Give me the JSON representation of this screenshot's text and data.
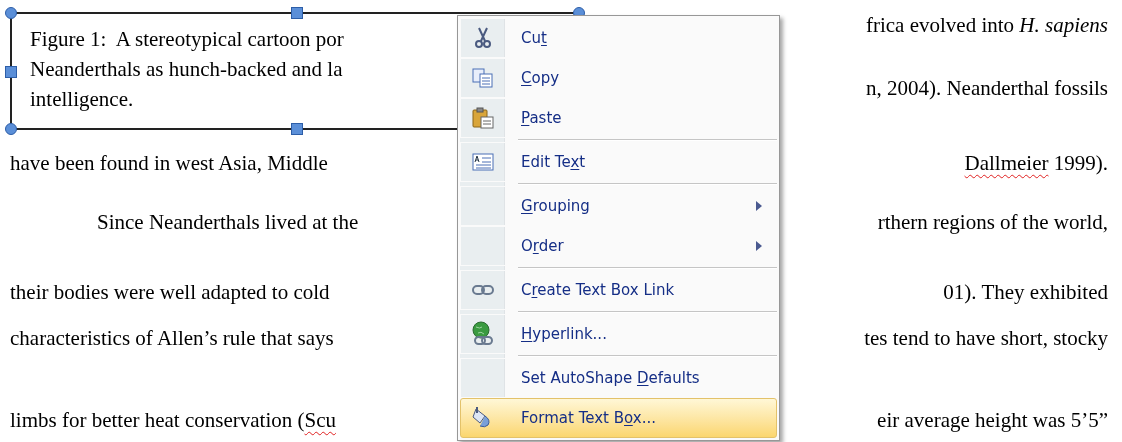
{
  "text_box": {
    "selected": true,
    "lines": [
      "Figure 1:  A stereotypical cartoon por",
      "Neanderthals as hunch-backed and la",
      "intelligence."
    ]
  },
  "beside_box": [
    {
      "right": [
        {
          "text": "frica evolved into *H. sapiens*"
        }
      ]
    },
    {
      "right": [
        {
          "text": "n, 2004). Neanderthal fossils"
        }
      ]
    }
  ],
  "paragraph_lines": [
    {
      "indent": false,
      "left": [
        {
          "text": "have been found in west Asia, Middle"
        }
      ],
      "right": [
        {
          "text": "Dallmeier",
          "misspelled": true
        },
        {
          "text": " 1999)."
        }
      ]
    },
    {
      "indent": true,
      "left": [
        {
          "text": "Since Neanderthals lived at the"
        }
      ],
      "right": [
        {
          "text": "rthern regions of the world,"
        }
      ]
    },
    {
      "indent": false,
      "left": [
        {
          "text": "their bodies were well adapted to cold"
        }
      ],
      "right": [
        {
          "text": "01). They exhibited"
        }
      ]
    },
    {
      "indent": false,
      "left": [
        {
          "text": "characteristics of Allen’s rule that says"
        }
      ],
      "right": [
        {
          "text": "tes tend to have short, stocky"
        }
      ]
    },
    {
      "indent": false,
      "left": [
        {
          "text": "limbs for better heat conservation ("
        },
        {
          "text": "Scu",
          "misspelled": true
        }
      ],
      "right": [
        {
          "text": "eir average height was 5’5”"
        }
      ]
    }
  ],
  "context_menu": {
    "items": [
      {
        "pre": "Cu",
        "key": "t",
        "selected": false
      },
      {
        "key": "C",
        "post": "opy",
        "selected": false
      },
      {
        "key": "P",
        "post": "aste",
        "selected": false,
        "separator_after": true
      },
      {
        "pre": "Edit Te",
        "key": "x",
        "post": "t",
        "selected": false,
        "separator_after": true
      },
      {
        "key": "G",
        "post": "rouping",
        "submenu": true,
        "selected": false
      },
      {
        "pre": "O",
        "key": "r",
        "post": "der",
        "submenu": true,
        "selected": false,
        "separator_after": true
      },
      {
        "pre": "C",
        "key": "r",
        "post": "eate Text Box Link",
        "selected": false,
        "separator_after": true
      },
      {
        "key": "H",
        "post": "yperlink...",
        "selected": false,
        "separator_after": true
      },
      {
        "pre": "Set AutoShape ",
        "key": "D",
        "post": "efaults",
        "selected": false
      },
      {
        "pre": "Format Text B",
        "key": "o",
        "post": "x...",
        "selected": true
      }
    ]
  }
}
